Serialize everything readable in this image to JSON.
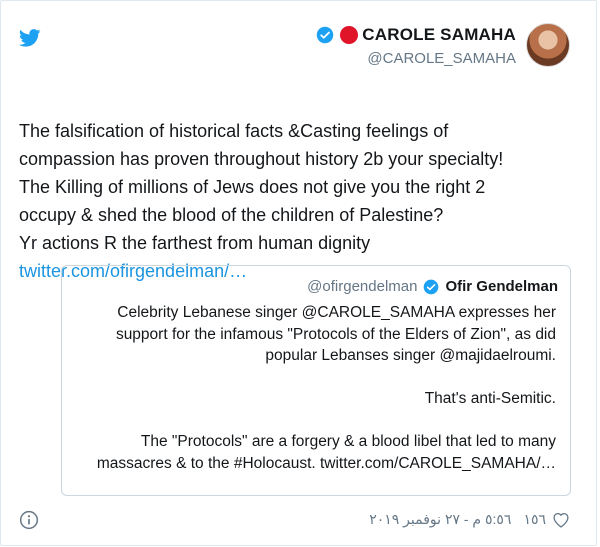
{
  "colors": {
    "link": "#1b95e0",
    "verified": "#1da1f2",
    "red_dot": "#e0152a",
    "muted": "#657786"
  },
  "header": {
    "display_name": "CAROLE SAMAHA",
    "handle": "@CAROLE_SAMAHA",
    "logo_icon": "twitter-bird-icon",
    "verified_icon": "verified-badge-icon"
  },
  "tweet": {
    "text": "The falsification of historical facts &Casting feelings of\ncompassion has proven throughout history 2b your specialty!\nThe Killing of millions of Jews does not give you the right 2\noccupy & shed the blood of the children of Palestine?\nYr actions R the farthest from human dignity",
    "link": "twitter.com/ofirgendelman/…"
  },
  "quoted_tweet": {
    "handle": "@ofirgendelman",
    "name": "Ofir Gendelman",
    "lines": [
      "Celebrity Lebanese singer @CAROLE_SAMAHA expresses her",
      "support for the infamous \"Protocols of the Elders of Zion\", as did",
      "popular Lebanses singer @majidaelroumi.",
      "",
      "That's anti-Semitic.",
      "",
      "The \"Protocols\" are a forgery & a blood libel that led to many",
      "massacres & to the #Holocaust. twitter.com/CAROLE_SAMAHA/…"
    ]
  },
  "footer": {
    "like_count": "١٥٦",
    "timestamp": "٥:٥٦ م - ٢٧ نوفمبر ٢٠١٩",
    "info_icon": "info-icon",
    "like_icon": "heart-icon"
  }
}
